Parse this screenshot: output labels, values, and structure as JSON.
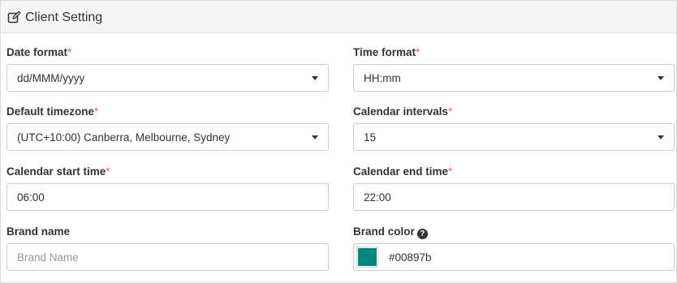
{
  "panel": {
    "title": "Client Setting",
    "icon": "edit-icon"
  },
  "fields": {
    "date_format": {
      "label": "Date format",
      "required_mark": "*",
      "value": "dd/MMM/yyyy"
    },
    "time_format": {
      "label": "Time format",
      "required_mark": "*",
      "value": "HH:mm"
    },
    "default_timezone": {
      "label": "Default timezone",
      "required_mark": "*",
      "value": "(UTC+10:00) Canberra, Melbourne, Sydney"
    },
    "calendar_intervals": {
      "label": "Calendar intervals",
      "required_mark": "*",
      "value": "15"
    },
    "calendar_start_time": {
      "label": "Calendar start time",
      "required_mark": "*",
      "value": "06:00"
    },
    "calendar_end_time": {
      "label": "Calendar end time",
      "required_mark": "*",
      "value": "22:00"
    },
    "brand_name": {
      "label": "Brand name",
      "value": "",
      "placeholder": "Brand Name"
    },
    "brand_color": {
      "label": "Brand color",
      "help_icon": "question-circle-icon",
      "value": "#00897b",
      "swatch_color": "#00897b"
    }
  },
  "colors": {
    "required": "#e06666",
    "border": "#cccccc",
    "heading_bg": "#f5f5f5"
  }
}
